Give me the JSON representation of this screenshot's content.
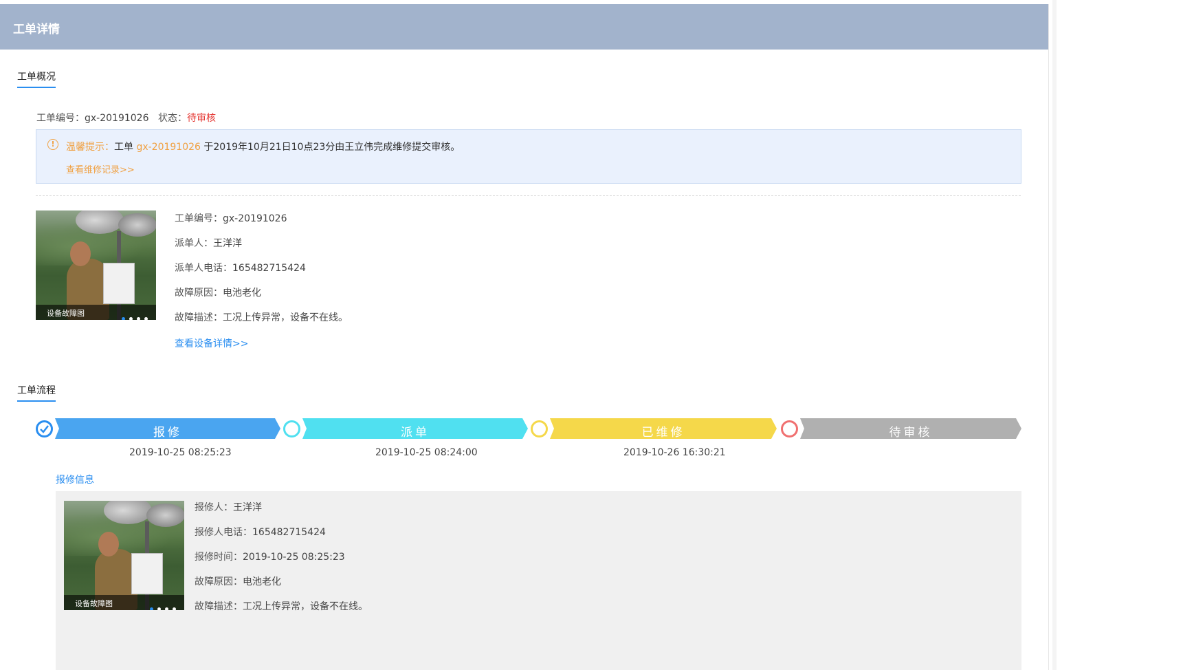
{
  "header": {
    "title": "工单详情"
  },
  "overview": {
    "section_title": "工单概况",
    "order_no_label": "工单编号：",
    "order_no": "gx-20191026",
    "status_label": "状态：",
    "status": "待审核",
    "tip": {
      "prefix": "温馨提示：",
      "text1": "工单 ",
      "order_no": "gx-20191026",
      "text2": " 于2019年10月21日10点23分由王立伟完成维修提交审核。",
      "link": "查看维修记录>>"
    },
    "photo_caption": "设备故障图",
    "details": [
      {
        "label": "工单编号：",
        "value": "gx-20191026"
      },
      {
        "label": "派单人：",
        "value": "王洋洋"
      },
      {
        "label": "派单人电话：",
        "value": "165482715424"
      },
      {
        "label": "故障原因：",
        "value": "电池老化"
      },
      {
        "label": "故障描述：",
        "value": "工况上传异常，设备不在线。"
      }
    ],
    "device_link": "查看设备详情>>"
  },
  "flow": {
    "section_title": "工单流程",
    "steps": [
      {
        "label": "报修",
        "time": "2019-10-25 08:25:23",
        "color": "#4aa5f0",
        "state": "done"
      },
      {
        "label": "派单",
        "time": "2019-10-25 08:24:00",
        "color": "#50e0f0",
        "state": "current"
      },
      {
        "label": "已维修",
        "time": "2019-10-26 16:30:21",
        "color": "#f5d84a",
        "state": "current"
      },
      {
        "label": "待审核",
        "time": "",
        "color": "#b0b0b0",
        "state": "pending"
      }
    ],
    "ring_colors": {
      "done": "#2a8ef0",
      "step2": "#50e0f0",
      "step3": "#f5d84a",
      "step4": "#f07070"
    }
  },
  "repair_info": {
    "title": "报修信息",
    "photo_caption": "设备故障图",
    "details": [
      {
        "label": "报修人：",
        "value": "王洋洋"
      },
      {
        "label": "报修人电话：",
        "value": "165482715424"
      },
      {
        "label": "报修时间：",
        "value": "2019-10-25 08:25:23"
      },
      {
        "label": "故障原因：",
        "value": "电池老化"
      },
      {
        "label": "故障描述：",
        "value": "工况上传异常，设备不在线。"
      }
    ]
  }
}
